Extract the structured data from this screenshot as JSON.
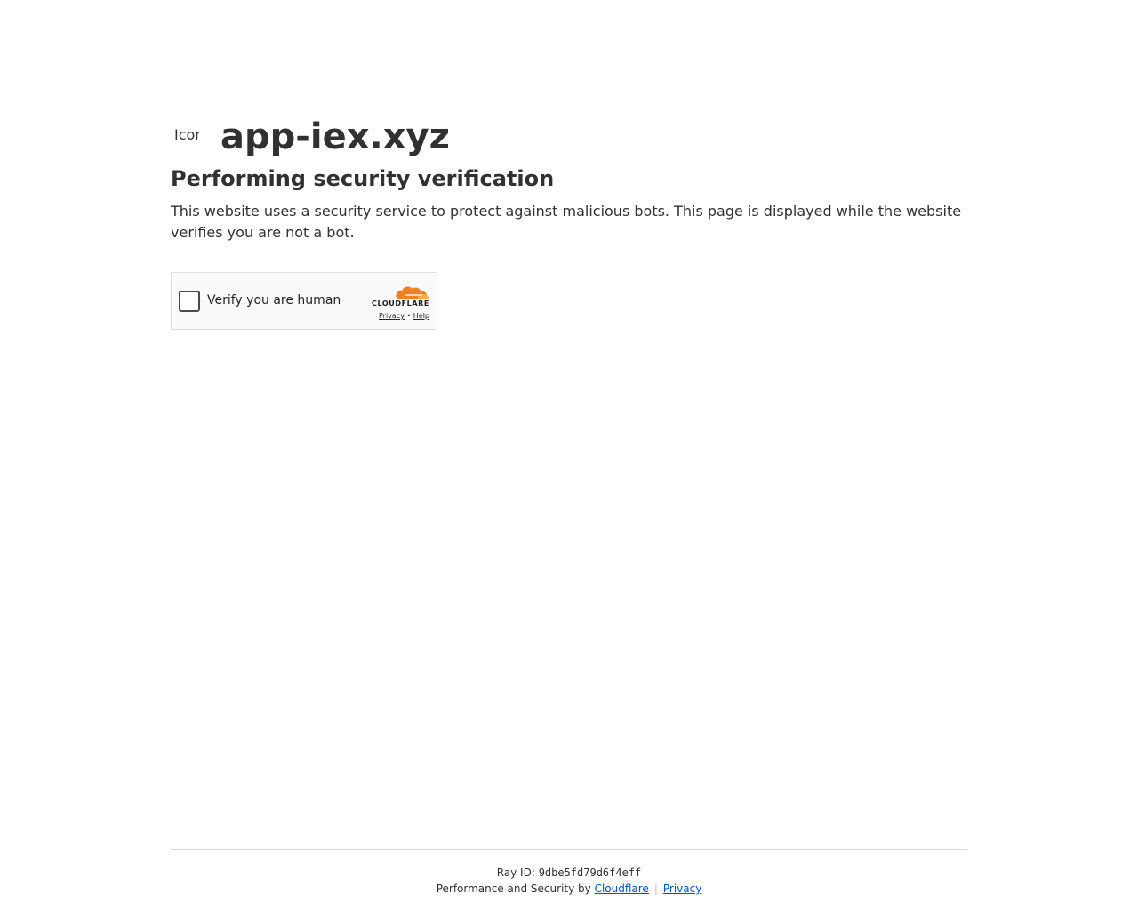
{
  "site": {
    "favicon_alt": "Icon for",
    "name": "app-iex.xyz"
  },
  "content": {
    "heading": "Performing security verification",
    "description": "This website uses a security service to protect against malicious bots. This page is displayed while the website verifies you are not a bot."
  },
  "widget": {
    "checkbox_label": "Verify you are human",
    "brand": "CLOUDFLARE",
    "privacy_link": "Privacy",
    "link_separator": "•",
    "help_link": "Help",
    "brand_color": "#f38020"
  },
  "footer": {
    "ray_label": "Ray ID: ",
    "ray_id": "9dbe5fd79d6f4eff",
    "perf_text": "Performance and Security by ",
    "cloudflare_link": "Cloudflare",
    "separator": "|",
    "privacy_link": "Privacy",
    "link_color": "#0051c3"
  }
}
